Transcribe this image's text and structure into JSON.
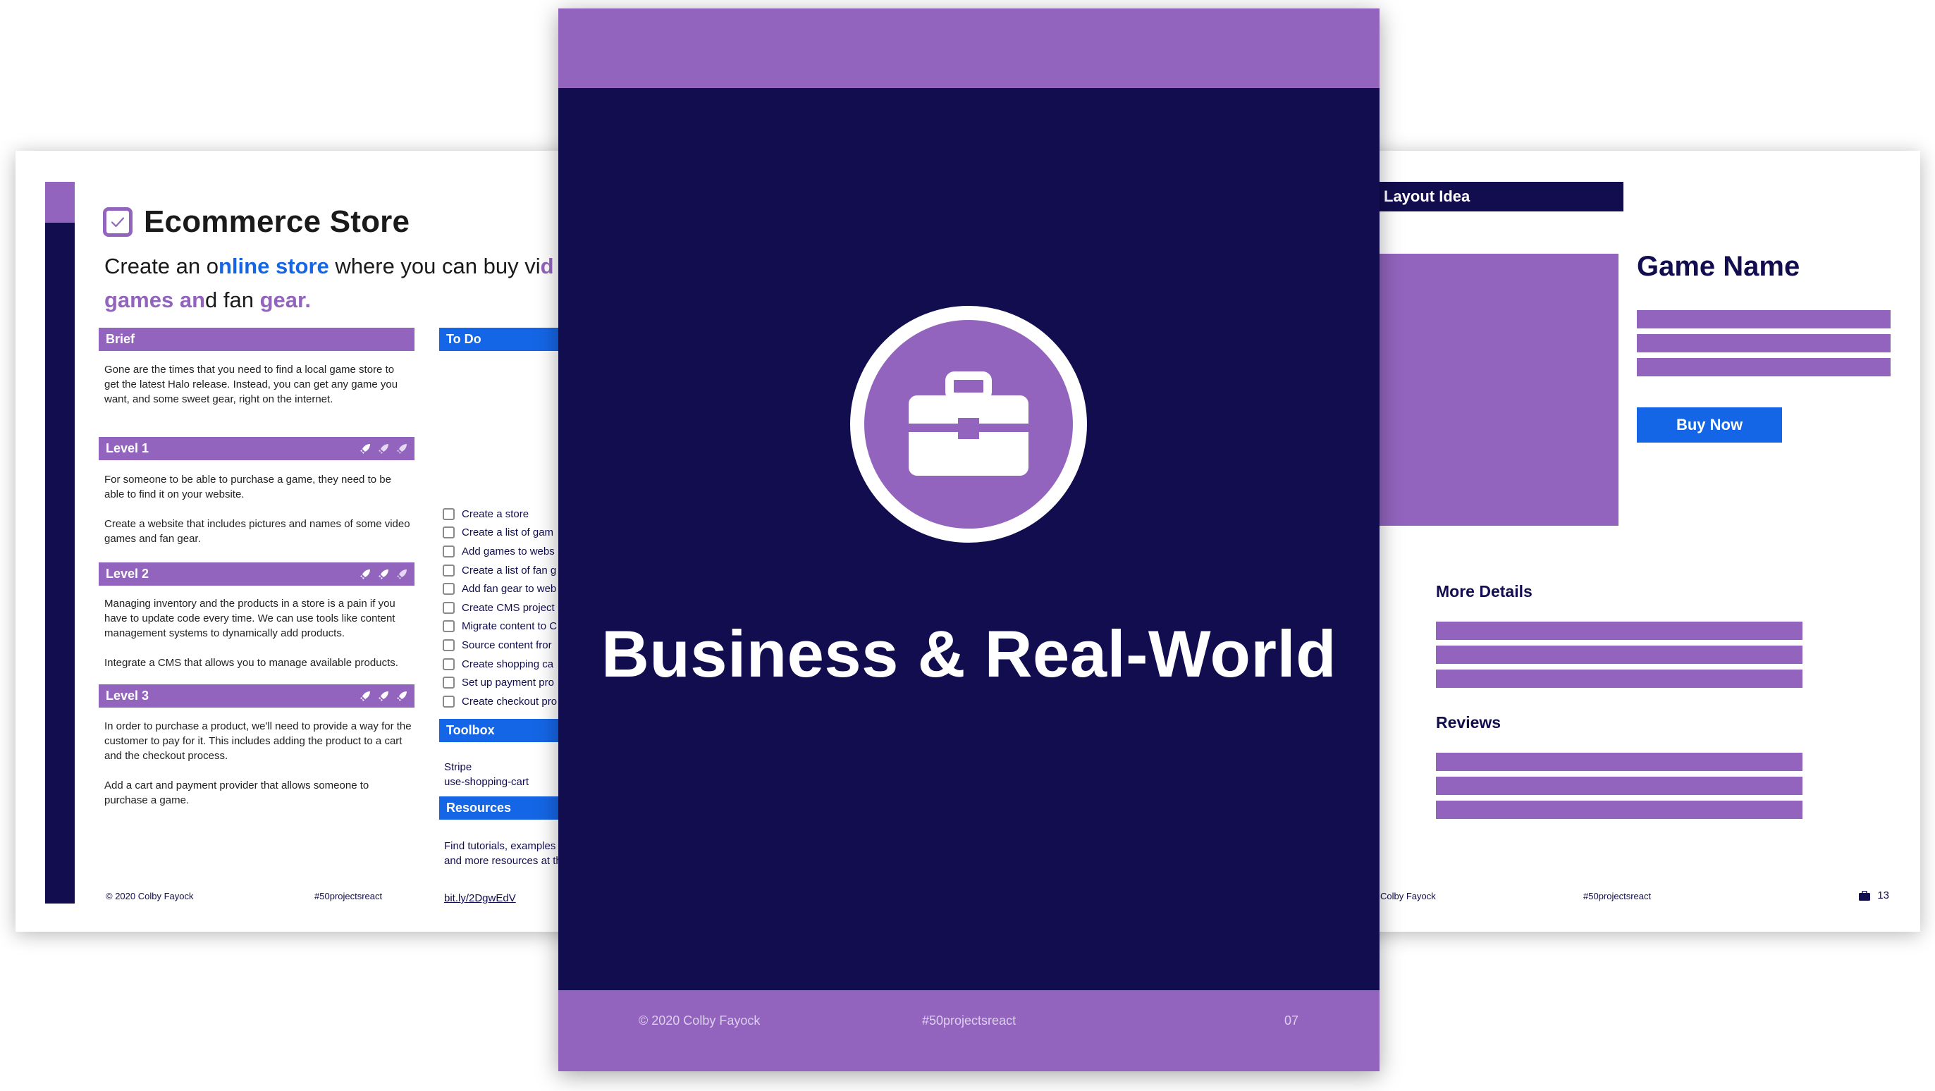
{
  "left_page": {
    "title": "Ecommerce Store",
    "subtitle": {
      "part1": "Create an o",
      "part2": "nline store",
      "part3": " where you can buy vi",
      "part4": "d",
      "part5": "games an",
      "part6": "d fan ",
      "part7": "gear."
    },
    "brief": {
      "label": "Brief",
      "text": "Gone are the times that you need to find a local game store to get the latest Halo release. Instead, you can get any game you want, and some sweet gear, right on the internet."
    },
    "level1": {
      "label": "Level 1",
      "text1": "For someone to be able to purchase a game, they need to be able to find it on your website.",
      "text2": "Create a website that includes pictures and names of some video games and fan gear."
    },
    "level2": {
      "label": "Level 2",
      "text1": "Managing inventory and the products in a store is a pain if you have to update code every time. We can use tools like content management systems to dynamically add products.",
      "text2": "Integrate a CMS that allows you to manage available products."
    },
    "level3": {
      "label": "Level 3",
      "text1": "In order to purchase a product, we'll need to provide a way for the customer to pay for it. This includes adding the product to a cart and the checkout process.",
      "text2": "Add a cart and payment provider that allows someone to purchase a game."
    },
    "todo": {
      "label": "To Do",
      "items": [
        "Create a store",
        "Create a list of gam",
        "Add games to webs",
        "Create a list of fan g",
        "Add fan gear to web",
        "Create CMS project",
        "Migrate content to C",
        "Source content fror",
        "Create shopping ca",
        "Set up payment pro",
        "Create checkout pro"
      ]
    },
    "toolbox": {
      "label": "Toolbox",
      "line1": "Stripe",
      "line2": "use-shopping-cart"
    },
    "resources": {
      "label": "Resources",
      "text": "Find tutorials, examples inspiration, and more resources at the link be",
      "link": "bit.ly/2DgwEdV"
    },
    "footer": {
      "copyright": "© 2020 Colby Fayock",
      "hashtag": "#50projectsreact"
    }
  },
  "center_page": {
    "title": "Business & Real-World",
    "icon": "briefcase-icon",
    "footer": {
      "copyright": "© 2020 Colby Fayock",
      "hashtag": "#50projectsreact",
      "page": "07"
    }
  },
  "right_page": {
    "layout_label": "Layout Idea",
    "game_name": "Game Name",
    "buy_button": "Buy Now",
    "more_details": "More Details",
    "reviews": "Reviews",
    "footer": {
      "copyright": "Colby Fayock",
      "hashtag": "#50projectsreact",
      "page": "13"
    }
  },
  "colors": {
    "navy": "#110d4f",
    "purple": "#9264bd",
    "blue": "#1566e6"
  }
}
